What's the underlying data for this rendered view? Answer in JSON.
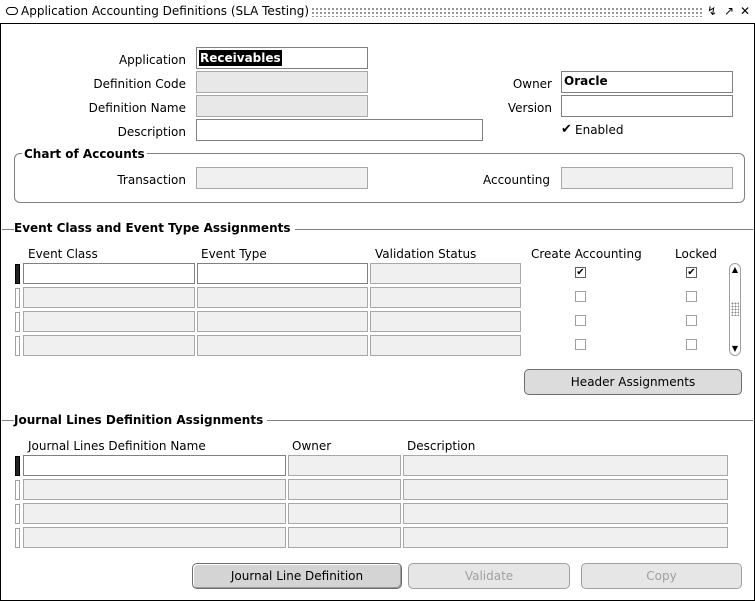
{
  "window": {
    "title": "Application Accounting Definitions (SLA Testing)",
    "controls": [
      "minimize-icon",
      "maximize-icon",
      "close-icon"
    ]
  },
  "header": {
    "application_label": "Application",
    "application_value": "Receivables",
    "definition_code_label": "Definition Code",
    "definition_code_value": "",
    "definition_name_label": "Definition Name",
    "definition_name_value": "",
    "description_label": "Description",
    "description_value": "",
    "owner_label": "Owner",
    "owner_value": "Oracle",
    "version_label": "Version",
    "version_value": "",
    "enabled_label": "Enabled",
    "enabled_checked": true
  },
  "chart_of_accounts": {
    "title": "Chart of Accounts",
    "transaction_label": "Transaction",
    "transaction_value": "",
    "accounting_label": "Accounting",
    "accounting_value": ""
  },
  "event_assignments": {
    "title": "Event Class and Event Type Assignments",
    "columns": [
      "Event Class",
      "Event Type",
      "Validation Status",
      "Create Accounting",
      "Locked"
    ],
    "rows": [
      {
        "event_class": "",
        "event_type": "",
        "validation_status": "",
        "create_accounting": true,
        "locked": true
      },
      {
        "event_class": "",
        "event_type": "",
        "validation_status": "",
        "create_accounting": false,
        "locked": false
      },
      {
        "event_class": "",
        "event_type": "",
        "validation_status": "",
        "create_accounting": false,
        "locked": false
      },
      {
        "event_class": "",
        "event_type": "",
        "validation_status": "",
        "create_accounting": false,
        "locked": false
      }
    ],
    "header_assignments_button": "Header Assignments"
  },
  "journal_lines": {
    "title": "Journal Lines Definition Assignments",
    "columns": [
      "Journal Lines Definition Name",
      "Owner",
      "Description"
    ],
    "rows": [
      {
        "name": "",
        "owner": "",
        "description": ""
      },
      {
        "name": "",
        "owner": "",
        "description": ""
      },
      {
        "name": "",
        "owner": "",
        "description": ""
      },
      {
        "name": "",
        "owner": "",
        "description": ""
      }
    ]
  },
  "footer": {
    "journal_line_definition_button": "Journal Line Definition",
    "validate_button": "Validate",
    "copy_button": "Copy"
  }
}
